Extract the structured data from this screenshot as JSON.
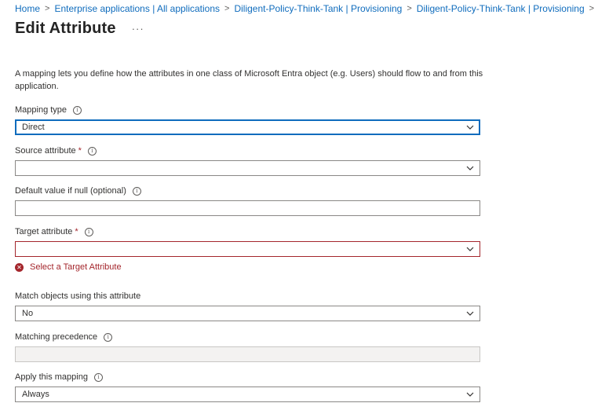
{
  "breadcrumb": {
    "items": [
      "Home",
      "Enterprise applications | All applications",
      "Diligent-Policy-Think-Tank | Provisioning",
      "Diligent-Policy-Think-Tank | Provisioning"
    ]
  },
  "header": {
    "title": "Edit Attribute",
    "more": "···"
  },
  "description": "A mapping lets you define how the attributes in one class of Microsoft Entra object (e.g. Users) should flow to and from this application.",
  "fields": {
    "mapping_type": {
      "label": "Mapping type",
      "value": "Direct"
    },
    "source_attribute": {
      "label": "Source attribute",
      "required": "*",
      "value": ""
    },
    "default_value": {
      "label": "Default value if null (optional)",
      "value": ""
    },
    "target_attribute": {
      "label": "Target attribute",
      "required": "*",
      "value": "",
      "error": "Select a Target Attribute"
    },
    "match_objects": {
      "label": "Match objects using this attribute",
      "value": "No"
    },
    "matching_precedence": {
      "label": "Matching precedence",
      "value": ""
    },
    "apply_mapping": {
      "label": "Apply this mapping",
      "value": "Always"
    }
  },
  "icons": {
    "info": "info-icon",
    "chevron": "chevron-down-icon",
    "error": "error-circle-icon",
    "breadcrumb_separator": "chevron-right-icon"
  },
  "colors": {
    "link": "#0f6cbd",
    "focus_border": "#0f6cbd",
    "error": "#a4262c"
  }
}
